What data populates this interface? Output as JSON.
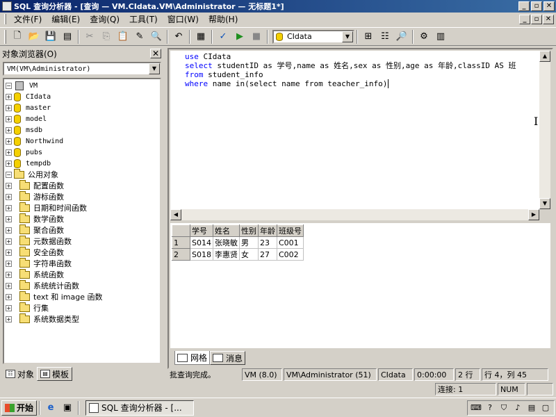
{
  "window": {
    "title": "SQL 查询分析器 - [查询 — VM.CIdata.VM\\Administrator — 无标题1*]",
    "minimize": "_",
    "restore": "▫",
    "close": "✕"
  },
  "menu": {
    "items": [
      "文件(F)",
      "编辑(E)",
      "查询(Q)",
      "工具(T)",
      "窗口(W)",
      "帮助(H)"
    ]
  },
  "toolbar": {
    "database_select": "CIdata",
    "icons": [
      "new-query-icon",
      "open-icon",
      "save-icon",
      "load-icon",
      "cut-icon",
      "copy-icon",
      "paste-icon",
      "insert-template-icon",
      "find-icon",
      "undo-icon",
      "results-grid-icon",
      "check-syntax-icon",
      "execute-icon",
      "stop-icon",
      "object-browser-icon",
      "object-search-icon",
      "display-plan-icon",
      "show-results-pane-icon",
      "properties-icon"
    ]
  },
  "object_browser": {
    "title": "对象浏览器(O)",
    "server_select": "VM(VM\\Administrator)",
    "tree": {
      "root": "VM",
      "databases": [
        "CIdata",
        "master",
        "model",
        "msdb",
        "Northwind",
        "pubs",
        "tempdb"
      ],
      "common_objects_label": "公用对象",
      "common_objects": [
        "配置函数",
        "游标函数",
        "日期和时间函数",
        "数学函数",
        "聚合函数",
        "元数据函数",
        "安全函数",
        "字符串函数",
        "系统函数",
        "系统统计函数",
        "text 和 image 函数",
        "行集",
        "系统数据类型"
      ]
    },
    "tabs": [
      "对象",
      "模板"
    ]
  },
  "editor": {
    "lines": [
      {
        "kw": "use",
        "rest": " CIdata"
      },
      {
        "kw": "select",
        "rest": " studentID as 学号,name as 姓名,sex as 性别,age as 年龄,classID AS 班"
      },
      {
        "kw": "from",
        "rest": " student_info"
      },
      {
        "kw": "where",
        "rest": " name in(select name from teacher_info)"
      }
    ]
  },
  "results": {
    "columns": [
      "学号",
      "姓名",
      "性别",
      "年龄",
      "班级号"
    ],
    "rows": [
      {
        "num": "1",
        "cells": [
          "S014",
          "张晓敏",
          "男",
          "23",
          "C001"
        ]
      },
      {
        "num": "2",
        "cells": [
          "S018",
          "李惠贤",
          "女",
          "27",
          "C002"
        ]
      }
    ],
    "tabs": [
      "网格",
      "消息"
    ]
  },
  "query_status": {
    "message": "批查询完成。",
    "server": "VM (8.0)",
    "user": "VM\\Administrator (51)",
    "database": "CIdata",
    "elapsed": "0:00:00",
    "rows": "2 行",
    "position": "行 4，列 45"
  },
  "app_status": {
    "connections": "连接: 1",
    "num": "NUM"
  },
  "taskbar": {
    "start": "开始",
    "task": "SQL 查询分析器 - [..."
  }
}
